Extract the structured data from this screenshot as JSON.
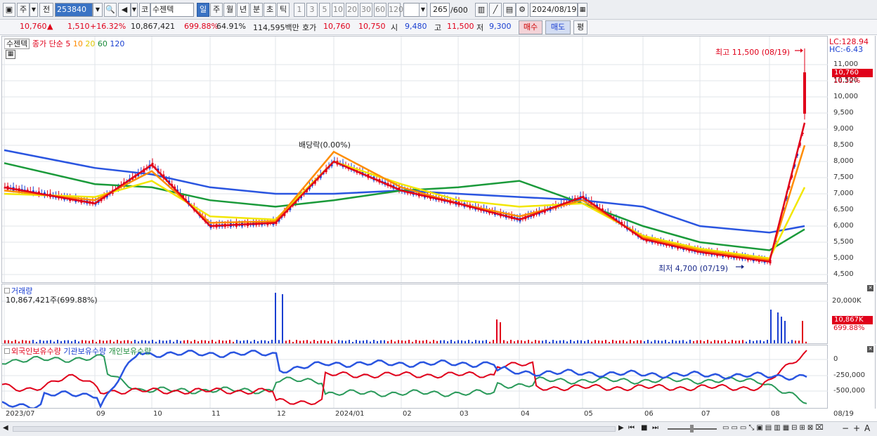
{
  "toolbar": {
    "type_label": "주",
    "prev_label": "전",
    "code": "253840",
    "market_label": "코",
    "name": "수젠텍",
    "periods": [
      "일",
      "주",
      "월",
      "년",
      "분",
      "초",
      "틱"
    ],
    "selected_period": "일",
    "intervals": [
      "1",
      "3",
      "5",
      "10",
      "20",
      "30",
      "60",
      "120"
    ],
    "count": "265",
    "count_total": "/600",
    "date": "2024/08/19"
  },
  "quote": {
    "price": "10,760",
    "change_arrow": "▲",
    "change": "1,510",
    "change_pct": "+16.32%",
    "volume": "10,867,421",
    "volume_ratio": "699.88%",
    "turnover": "64.91%",
    "trade_value": "114,595백만",
    "hoga_label": "호가",
    "ask": "10,760",
    "bid": "10,750",
    "open_label": "시",
    "open": "9,480",
    "high_label": "고",
    "high": "11,500",
    "low_label": "저",
    "low": "9,300",
    "buy_label": "매수",
    "sell_label": "매도",
    "eval_label": "평"
  },
  "legend": {
    "name": "수젠텍",
    "ma_label": "종가 단순",
    "ma5": "5",
    "ma10": "10",
    "ma20": "20",
    "ma60": "60",
    "ma120": "120"
  },
  "price_axis": {
    "lc": "LC:128.94",
    "hc": "HC:-6.43",
    "current_tag": "10,760",
    "pct_tag": "16.32%",
    "ticks": [
      "11,000",
      "10,500",
      "10,000",
      "9,500",
      "9,000",
      "8,500",
      "8,000",
      "7,500",
      "7,000",
      "6,500",
      "6,000",
      "5,500",
      "5,000",
      "4,500"
    ]
  },
  "annotations": {
    "high": "최고 11,500 (08/19)",
    "low": "최저 4,700 (07/19)",
    "dividend": "배당락(0.00%)"
  },
  "volume_panel": {
    "title": "거래량",
    "value": "10,867,421주(699.88%)",
    "tick": "20,000K",
    "current_tag": "10,867K",
    "pct_tag": "699.88%"
  },
  "holdings_panel": {
    "foreign": "외국인보유수량",
    "institution": "기관보유수량",
    "individual": "개인보유수량",
    "ticks": [
      "0",
      "-250,000",
      "-500,000"
    ]
  },
  "x_axis": [
    "2023/07",
    "09",
    "10",
    "11",
    "12",
    "2024/01",
    "02",
    "03",
    "04",
    "05",
    "06",
    "07",
    "08",
    "08/19"
  ],
  "colors": {
    "up": "#e0001a",
    "down": "#1a3fd1",
    "ma5": "#e0001a",
    "ma10": "#ff8c00",
    "ma20": "#f2e600",
    "ma60": "#1a9a3a",
    "ma120": "#2a55e0"
  },
  "chart_data": {
    "type": "line",
    "title": "",
    "xlabel": "",
    "ylabel": "",
    "ylim": [
      4400,
      11500
    ],
    "x": [
      "2023/07",
      "09",
      "10",
      "11",
      "12",
      "2024/01",
      "02",
      "03",
      "04",
      "05",
      "06",
      "07",
      "08",
      "08/19"
    ],
    "series": [
      {
        "name": "5",
        "values": [
          7200,
          6700,
          7900,
          6000,
          6100,
          8000,
          7100,
          6700,
          6200,
          6900,
          5600,
          5200,
          4900,
          9200
        ]
      },
      {
        "name": "10",
        "values": [
          7100,
          6800,
          7700,
          6100,
          6150,
          8300,
          7200,
          6700,
          6300,
          6800,
          5650,
          5250,
          4950,
          8500
        ]
      },
      {
        "name": "20",
        "values": [
          7000,
          6900,
          7400,
          6300,
          6200,
          8000,
          7300,
          6800,
          6600,
          6700,
          5700,
          5300,
          5000,
          7200
        ]
      },
      {
        "name": "60",
        "values": [
          7950,
          7300,
          7200,
          6800,
          6600,
          6800,
          7100,
          7200,
          7400,
          6700,
          6000,
          5500,
          5250,
          5900
        ]
      },
      {
        "name": "120",
        "values": [
          8350,
          7800,
          7600,
          7200,
          7000,
          7000,
          7100,
          7000,
          6900,
          6800,
          6600,
          6000,
          5800,
          6000
        ]
      }
    ]
  }
}
